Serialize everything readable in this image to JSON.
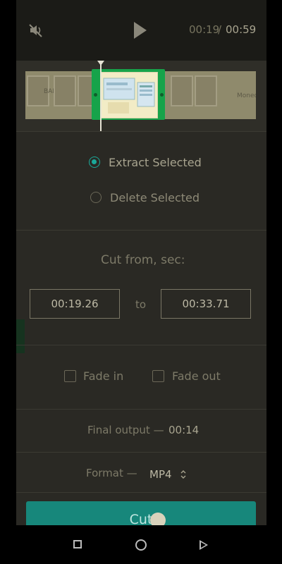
{
  "player": {
    "current_time": "00:19",
    "separator": "/",
    "total_time": "00:59"
  },
  "icons": {
    "mute": "muted-speaker-icon",
    "play": "play-icon"
  },
  "timeline": {
    "thumbnail_labels": [
      "BANK",
      "Moned"
    ]
  },
  "mode": {
    "options": [
      {
        "label": "Extract Selected",
        "selected": true
      },
      {
        "label": "Delete Selected",
        "selected": false
      }
    ]
  },
  "cut_range": {
    "label": "Cut from, sec:",
    "from": "00:19.26",
    "to_label": "to",
    "to": "00:33.71"
  },
  "fades": {
    "fade_in_label": "Fade in",
    "fade_out_label": "Fade out"
  },
  "output": {
    "label": "Final output —",
    "duration": "00:14"
  },
  "format": {
    "label": "Format —",
    "value": "MP4"
  },
  "actions": {
    "cut_label": "Cut"
  },
  "colors": {
    "accent": "#1ba99a",
    "selection": "#16a34a",
    "button": "#17877b"
  }
}
